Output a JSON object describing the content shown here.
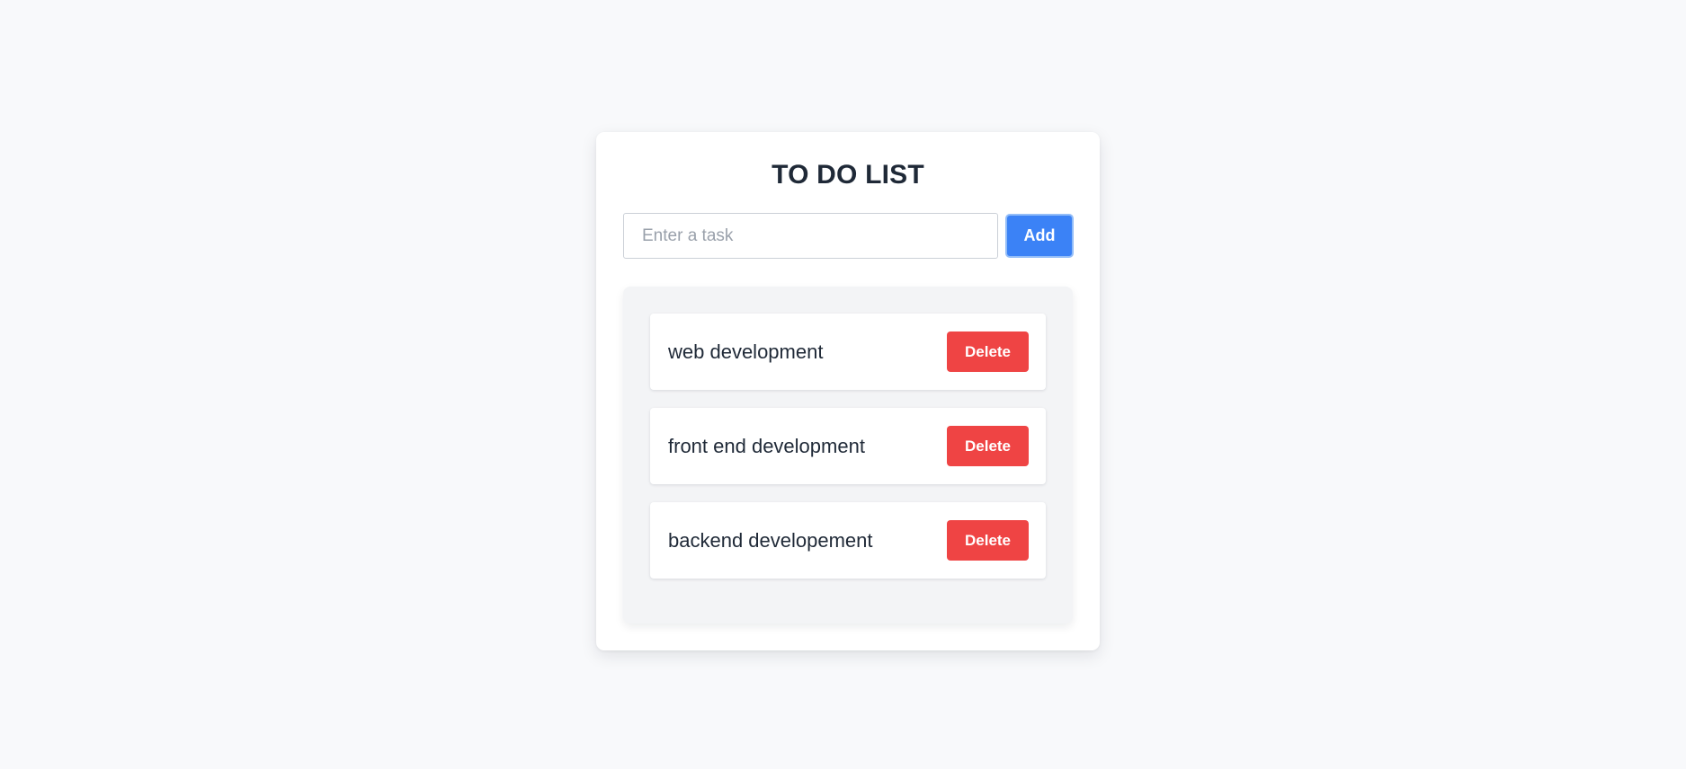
{
  "app": {
    "title": "TO DO LIST"
  },
  "input": {
    "placeholder": "Enter a task",
    "value": ""
  },
  "add_button": {
    "label": "Add"
  },
  "tasks": [
    {
      "text": "web development",
      "delete_label": "Delete"
    },
    {
      "text": "front end development",
      "delete_label": "Delete"
    },
    {
      "text": "backend developement",
      "delete_label": "Delete"
    }
  ],
  "colors": {
    "page_background": "#f8f9fb",
    "card_background": "#ffffff",
    "list_background": "#f3f4f6",
    "title_text": "#1f2937",
    "add_button": "#3b82f6",
    "delete_button": "#ef4444"
  }
}
